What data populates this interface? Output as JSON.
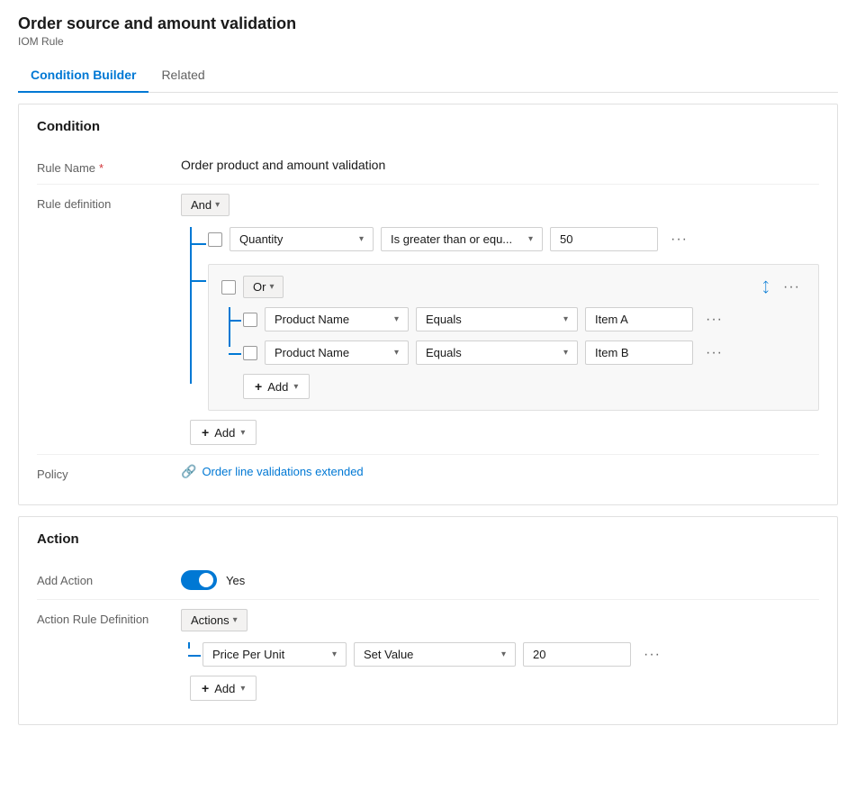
{
  "page": {
    "title": "Order source and amount validation",
    "subtitle": "IOM Rule"
  },
  "tabs": [
    {
      "id": "condition-builder",
      "label": "Condition Builder",
      "active": true
    },
    {
      "id": "related",
      "label": "Related",
      "active": false
    }
  ],
  "condition_section": {
    "title": "Condition",
    "rule_name_label": "Rule Name",
    "rule_name_value": "Order product and amount validation",
    "rule_definition_label": "Rule definition",
    "policy_label": "Policy",
    "policy_link_text": "Order line validations extended",
    "logic_and": "And",
    "logic_or": "Or",
    "rows": [
      {
        "field": "Quantity",
        "operator": "Is greater than or equ...",
        "value": "50"
      }
    ],
    "or_group": {
      "rows": [
        {
          "field": "Product Name",
          "operator": "Equals",
          "value": "Item A"
        },
        {
          "field": "Product Name",
          "operator": "Equals",
          "value": "Item B"
        }
      ],
      "add_label": "Add"
    },
    "add_label": "Add"
  },
  "action_section": {
    "title": "Action",
    "add_action_label": "Add Action",
    "add_action_value": "Yes",
    "action_rule_def_label": "Action Rule Definition",
    "logic_actions": "Actions",
    "rows": [
      {
        "field": "Price Per Unit",
        "operator": "Set Value",
        "value": "20"
      }
    ],
    "add_label": "Add"
  },
  "icons": {
    "chevron": "▾",
    "plus": "+",
    "dots": "···",
    "collapse": "⤡",
    "policy": "🔗"
  }
}
